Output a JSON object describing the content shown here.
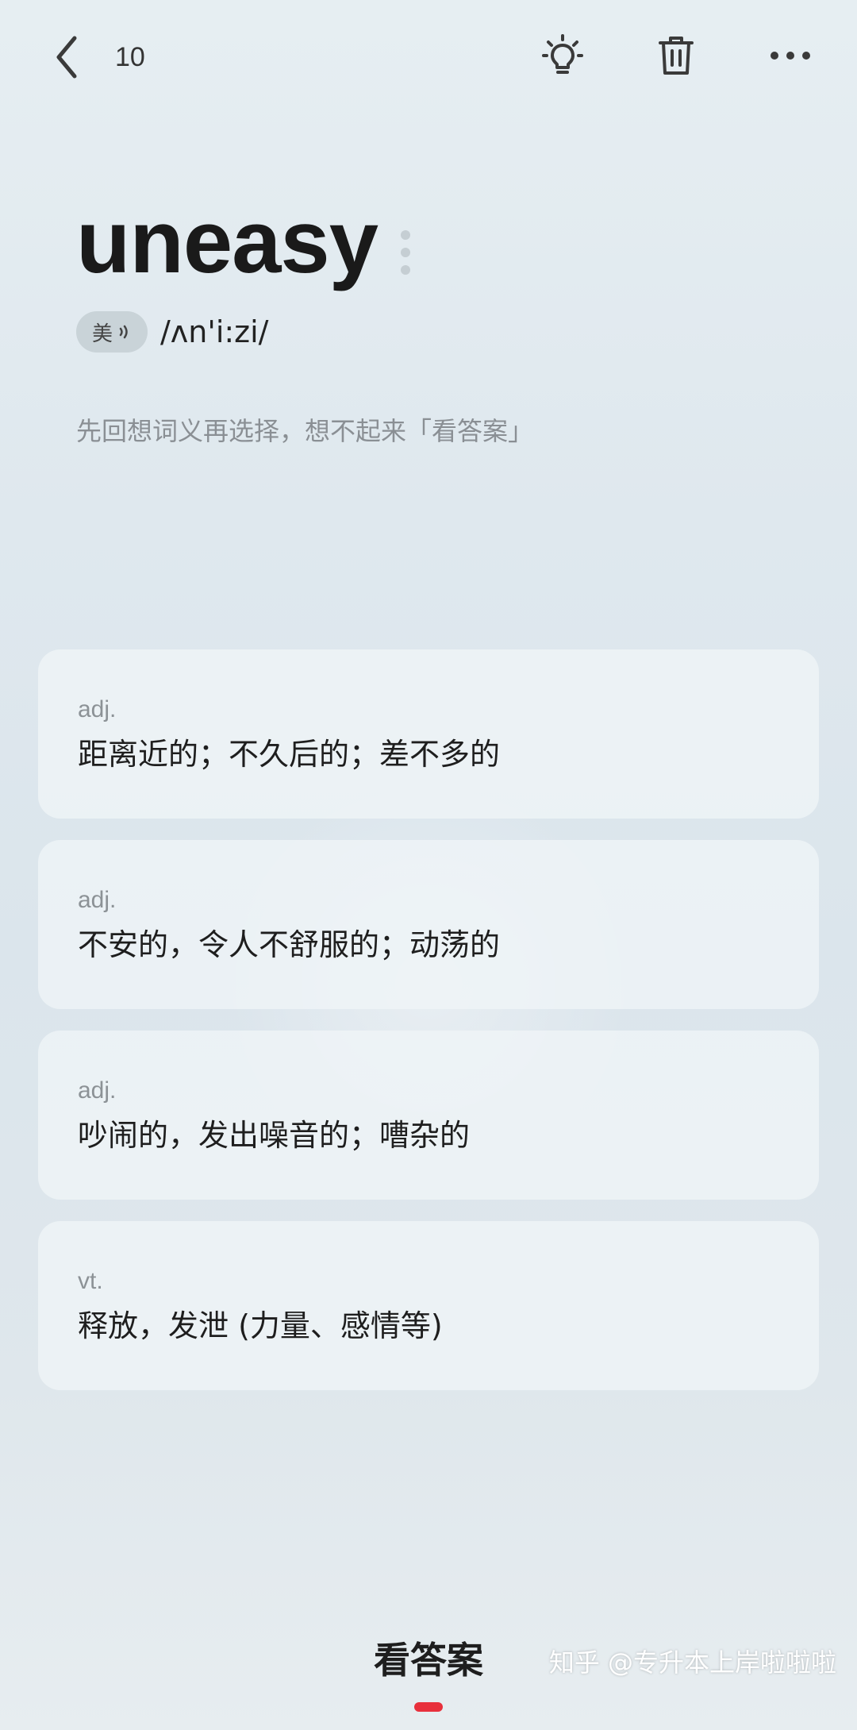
{
  "header": {
    "count": "10",
    "back_icon": "chevron-left-icon",
    "hint_icon": "lightbulb-icon",
    "trash_icon": "trash-icon",
    "more_icon": "more-dots-icon"
  },
  "word": {
    "text": "uneasy",
    "accent_label": "美",
    "phonetic": "/ʌn'i:zi/"
  },
  "instruction": "先回想词义再选择，想不起来「看答案」",
  "options": [
    {
      "pos": "adj.",
      "meaning": "距离近的；不久后的；差不多的"
    },
    {
      "pos": "adj.",
      "meaning": "不安的，令人不舒服的；动荡的"
    },
    {
      "pos": "adj.",
      "meaning": "吵闹的，发出噪音的；嘈杂的"
    },
    {
      "pos": "vt.",
      "meaning": "释放，发泄 (力量、感情等)"
    }
  ],
  "footer": {
    "show_answer_label": "看答案",
    "watermark": "知乎 @专升本上岸啦啦啦"
  },
  "colors": {
    "accent": "#e8303c",
    "text_primary": "#1e1e1e",
    "text_secondary": "#8a8f94"
  }
}
